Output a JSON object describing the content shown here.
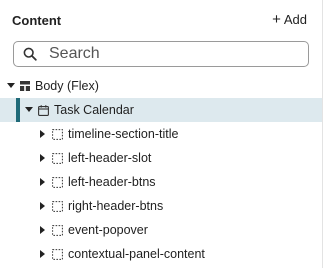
{
  "panel": {
    "title": "Content",
    "add_label": "Add",
    "add_icon": "plus-icon"
  },
  "search": {
    "placeholder": "Search",
    "value": "",
    "icon": "search-icon"
  },
  "tree": {
    "root": {
      "label": "Body (Flex)",
      "icon": "flex-layout-icon",
      "expanded": true
    },
    "calendar": {
      "label": "Task Calendar",
      "icon": "calendar-icon",
      "expanded": true,
      "selected": true
    },
    "children": [
      {
        "label": "timeline-section-title",
        "icon": "dashed-box-icon",
        "expanded": false
      },
      {
        "label": "left-header-slot",
        "icon": "dashed-box-icon",
        "expanded": false
      },
      {
        "label": "left-header-btns",
        "icon": "dashed-box-icon",
        "expanded": false
      },
      {
        "label": "right-header-btns",
        "icon": "dashed-box-icon",
        "expanded": false
      },
      {
        "label": "event-popover",
        "icon": "dashed-box-icon",
        "expanded": false
      },
      {
        "label": "contextual-panel-content",
        "icon": "dashed-box-icon",
        "expanded": false
      }
    ]
  },
  "colors": {
    "selected_bg": "#dde9ee",
    "selected_bar": "#1f6a78",
    "search_border": "#9a9a9a"
  }
}
